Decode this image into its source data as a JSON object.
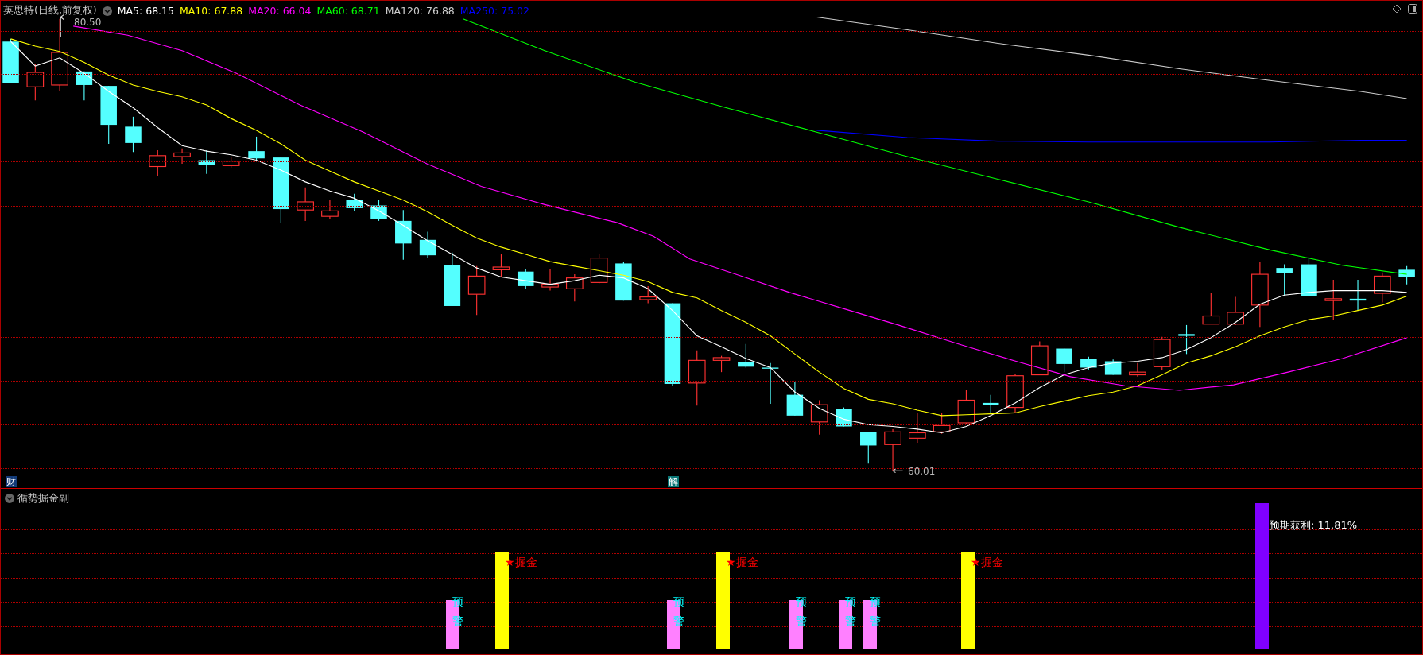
{
  "chart": {
    "title": "英思特(日线,前复权)",
    "indicators": [
      {
        "label": "MA5: 68.15",
        "color": "#ffffff"
      },
      {
        "label": "MA10: 67.88",
        "color": "#ffff00"
      },
      {
        "label": "MA20: 66.04",
        "color": "#ff00ff"
      },
      {
        "label": "MA60: 68.71",
        "color": "#00ff00"
      },
      {
        "label": "MA120: 76.88",
        "color": "#cccccc"
      },
      {
        "label": "MA250: 75.02",
        "color": "#0000ff"
      }
    ],
    "high_label": "80.50",
    "low_label": "60.01",
    "markers": [
      {
        "text": "财",
        "kind": "finance"
      },
      {
        "text": "解",
        "kind": "unlock"
      }
    ]
  },
  "sub_chart": {
    "title": "循势掘金副",
    "bars": [
      {
        "kind": "warning",
        "labels": [
          "预",
          "警"
        ]
      },
      {
        "kind": "gold",
        "labels": [
          "★掘金"
        ]
      },
      {
        "kind": "warning",
        "labels": [
          "预",
          "警"
        ]
      },
      {
        "kind": "gold",
        "labels": [
          "★掘金"
        ]
      },
      {
        "kind": "warning",
        "labels": [
          "预",
          "警"
        ]
      },
      {
        "kind": "warning",
        "labels": [
          "预",
          "警"
        ]
      },
      {
        "kind": "warning",
        "labels": [
          "预",
          "警"
        ]
      },
      {
        "kind": "gold",
        "labels": [
          "★掘金"
        ]
      },
      {
        "kind": "profit",
        "labels": [
          "预期获利: 11.81%"
        ]
      }
    ]
  }
}
